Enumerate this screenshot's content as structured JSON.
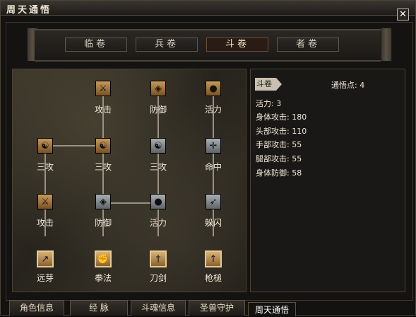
{
  "window": {
    "title": "周天通悟"
  },
  "top_tabs": [
    {
      "label": "临卷"
    },
    {
      "label": "兵卷"
    },
    {
      "label": "斗卷"
    },
    {
      "label": "者卷"
    }
  ],
  "active_top_tab": "斗卷",
  "tree_nodes": [
    {
      "label": "攻击"
    },
    {
      "label": "防御"
    },
    {
      "label": "活力"
    },
    {
      "label": "三攻"
    },
    {
      "label": "三攻"
    },
    {
      "label": "三攻"
    },
    {
      "label": "命中"
    },
    {
      "label": "攻击"
    },
    {
      "label": "防御"
    },
    {
      "label": "活力"
    },
    {
      "label": "躲闪"
    },
    {
      "label": "远芽"
    },
    {
      "label": "拳法"
    },
    {
      "label": "刀剑"
    },
    {
      "label": "枪槌"
    }
  ],
  "info": {
    "tag": "斗卷",
    "points": "通悟点: 4",
    "stats": [
      "活力: 3",
      "身体攻击: 180",
      "头部攻击: 110",
      "手部攻击: 55",
      "腿部攻击: 55",
      "身体防御: 58"
    ]
  },
  "bottom_tabs": [
    {
      "label": "角色信息"
    },
    {
      "label": "经 脉"
    },
    {
      "label": "斗魂信息"
    },
    {
      "label": "圣兽守护"
    },
    {
      "label": "周天通悟"
    }
  ],
  "active_bottom_tab": "周天通悟",
  "colors": {
    "accent_gold": "#d7b277",
    "border": "#5a5244",
    "text": "#f0e8d8"
  }
}
